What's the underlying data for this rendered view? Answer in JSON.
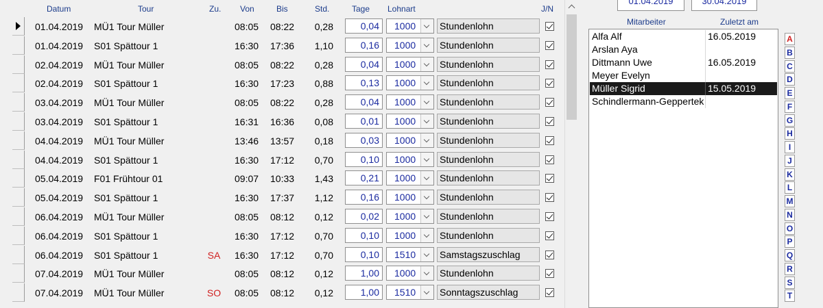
{
  "grid": {
    "headers": {
      "datum": "Datum",
      "tour": "Tour",
      "zu": "Zu.",
      "von": "Von",
      "bis": "Bis",
      "std": "Std.",
      "tage": "Tage",
      "lohnart": "Lohnart",
      "jn": "J/N"
    },
    "rows": [
      {
        "datum": "01.04.2019",
        "tour": "MÜ1 Tour Müller",
        "zu": "",
        "von": "08:05",
        "bis": "08:22",
        "std": "0,28",
        "tage": "0,04",
        "lohnart": "1000",
        "lohnname": "Stundenlohn",
        "jn": true,
        "current": true
      },
      {
        "datum": "01.04.2019",
        "tour": "S01 Spättour 1",
        "zu": "",
        "von": "16:30",
        "bis": "17:36",
        "std": "1,10",
        "tage": "0,16",
        "lohnart": "1000",
        "lohnname": "Stundenlohn",
        "jn": true
      },
      {
        "datum": "02.04.2019",
        "tour": "MÜ1 Tour Müller",
        "zu": "",
        "von": "08:05",
        "bis": "08:22",
        "std": "0,28",
        "tage": "0,04",
        "lohnart": "1000",
        "lohnname": "Stundenlohn",
        "jn": true
      },
      {
        "datum": "02.04.2019",
        "tour": "S01 Spättour 1",
        "zu": "",
        "von": "16:30",
        "bis": "17:23",
        "std": "0,88",
        "tage": "0,13",
        "lohnart": "1000",
        "lohnname": "Stundenlohn",
        "jn": true
      },
      {
        "datum": "03.04.2019",
        "tour": "MÜ1 Tour Müller",
        "zu": "",
        "von": "08:05",
        "bis": "08:22",
        "std": "0,28",
        "tage": "0,04",
        "lohnart": "1000",
        "lohnname": "Stundenlohn",
        "jn": true
      },
      {
        "datum": "03.04.2019",
        "tour": "S01 Spättour 1",
        "zu": "",
        "von": "16:31",
        "bis": "16:36",
        "std": "0,08",
        "tage": "0,01",
        "lohnart": "1000",
        "lohnname": "Stundenlohn",
        "jn": true
      },
      {
        "datum": "04.04.2019",
        "tour": "MÜ1 Tour Müller",
        "zu": "",
        "von": "13:46",
        "bis": "13:57",
        "std": "0,18",
        "tage": "0,03",
        "lohnart": "1000",
        "lohnname": "Stundenlohn",
        "jn": true
      },
      {
        "datum": "04.04.2019",
        "tour": "S01 Spättour 1",
        "zu": "",
        "von": "16:30",
        "bis": "17:12",
        "std": "0,70",
        "tage": "0,10",
        "lohnart": "1000",
        "lohnname": "Stundenlohn",
        "jn": true
      },
      {
        "datum": "05.04.2019",
        "tour": "F01 Frühtour 01",
        "zu": "",
        "von": "09:07",
        "bis": "10:33",
        "std": "1,43",
        "tage": "0,21",
        "lohnart": "1000",
        "lohnname": "Stundenlohn",
        "jn": true
      },
      {
        "datum": "05.04.2019",
        "tour": "S01 Spättour 1",
        "zu": "",
        "von": "16:30",
        "bis": "17:37",
        "std": "1,12",
        "tage": "0,16",
        "lohnart": "1000",
        "lohnname": "Stundenlohn",
        "jn": true
      },
      {
        "datum": "06.04.2019",
        "tour": "MÜ1 Tour Müller",
        "zu": "",
        "von": "08:05",
        "bis": "08:12",
        "std": "0,12",
        "tage": "0,02",
        "lohnart": "1000",
        "lohnname": "Stundenlohn",
        "jn": true
      },
      {
        "datum": "06.04.2019",
        "tour": "S01 Spättour 1",
        "zu": "",
        "von": "16:30",
        "bis": "17:12",
        "std": "0,70",
        "tage": "0,10",
        "lohnart": "1000",
        "lohnname": "Stundenlohn",
        "jn": true
      },
      {
        "datum": "06.04.2019",
        "tour": "S01 Spättour 1",
        "zu": "SA",
        "von": "16:30",
        "bis": "17:12",
        "std": "0,70",
        "tage": "0,10",
        "lohnart": "1510",
        "lohnname": "Samstagszuschlag",
        "jn": true
      },
      {
        "datum": "07.04.2019",
        "tour": "MÜ1 Tour Müller",
        "zu": "",
        "von": "08:05",
        "bis": "08:12",
        "std": "0,12",
        "tage": "1,00",
        "lohnart": "1000",
        "lohnname": "Stundenlohn",
        "jn": true
      },
      {
        "datum": "07.04.2019",
        "tour": "MÜ1 Tour Müller",
        "zu": "SO",
        "von": "08:05",
        "bis": "08:12",
        "std": "0,12",
        "tage": "1,00",
        "lohnart": "1510",
        "lohnname": "Sonntagszuschlag",
        "jn": true
      }
    ]
  },
  "period": {
    "from": "01.04.2019",
    "to": "30.04.2019"
  },
  "employees": {
    "header_name": "Mitarbeiter",
    "header_date": "Zuletzt am",
    "rows": [
      {
        "name": "Alfa Alf",
        "date": "16.05.2019"
      },
      {
        "name": "Arslan Aya",
        "date": ""
      },
      {
        "name": "Dittmann Uwe",
        "date": "16.05.2019"
      },
      {
        "name": "Meyer Evelyn",
        "date": ""
      },
      {
        "name": "Müller Sigrid",
        "date": "15.05.2019",
        "selected": true
      },
      {
        "name": "Schindlermann-Geppertek",
        "date": ""
      }
    ]
  },
  "alphabet": [
    "A",
    "B",
    "C",
    "D",
    "E",
    "F",
    "G",
    "H",
    "I",
    "J",
    "K",
    "L",
    "M",
    "N",
    "O",
    "P",
    "Q",
    "R",
    "S",
    "T"
  ],
  "alphabet_active": "A"
}
